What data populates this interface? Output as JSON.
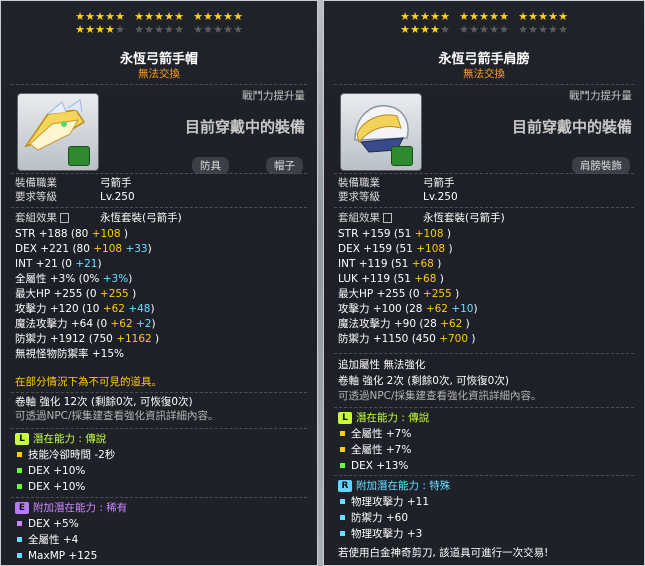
{
  "left": {
    "stars": {
      "row1": 15,
      "row2_on": 4,
      "row2_total": 15
    },
    "title": "永恆弓箭手帽",
    "untradeable": "無法交換",
    "cp_label": "戰鬥力提升量",
    "equipped": "目前穿戴中的裝備",
    "tags": [
      "防具",
      "帽子"
    ],
    "job_label": "裝備職業",
    "job": "弓箭手",
    "level_label": "要求等級",
    "level": "Lv.250",
    "set_label": "套組效果",
    "set": "永恆套裝(弓箭手)",
    "stats": [
      {
        "name": "STR",
        "total": "+188",
        "base": "(80",
        "a": "+108",
        "b": "",
        "close": ")"
      },
      {
        "name": "DEX",
        "total": "+221",
        "base": "(80",
        "a": "+108",
        "b": "+33",
        "close": ")"
      },
      {
        "name": "INT",
        "total": "+21",
        "base": "(0",
        "a": "",
        "b": "+21",
        "close": ")"
      },
      {
        "name": "全屬性",
        "total": "+3%",
        "base": "(0%",
        "a": "",
        "b": "+3%",
        "close": ")"
      },
      {
        "name": "最大HP",
        "total": "+255",
        "base": "(0",
        "a": "+255",
        "b": "",
        "close": ")"
      },
      {
        "name": "攻擊力",
        "total": "+120",
        "base": "(10",
        "a": "+62",
        "b": "+48",
        "close": ")"
      },
      {
        "name": "魔法攻擊力",
        "total": "+64",
        "base": "(0",
        "a": "+62",
        "b": "+2",
        "close": ")"
      },
      {
        "name": "防禦力",
        "total": "+1912",
        "base": "(750",
        "a": "+1162",
        "b": "",
        "close": ")"
      },
      {
        "name": "無視怪物防禦率",
        "total": "+15%",
        "base": "",
        "a": "",
        "b": "",
        "close": ""
      }
    ],
    "note_invisible": "在部分情況下為不可見的道具。",
    "scroll": "卷軸 強化 12次 (剩餘0次, 可恢復0次)",
    "npc_note": "可透過NPC/採集建查看強化資訊詳細內容。",
    "potential_title": "潛在能力 : 傳說",
    "potential": [
      "技能冷卻時間 -2秒",
      "DEX +10%",
      "DEX +10%"
    ],
    "add_potential_title": "附加潛在能力 : 稀有",
    "add_potential": [
      "DEX +5%",
      "全屬性 +4",
      "MaxMP +125"
    ]
  },
  "right": {
    "stars": {
      "row1": 15,
      "row2_on": 4,
      "row2_total": 15
    },
    "title": "永恆弓箭手肩膀",
    "untradeable": "無法交換",
    "cp_label": "戰鬥力提升量",
    "equipped": "目前穿戴中的裝備",
    "tags": [
      "肩膀裝飾"
    ],
    "job_label": "裝備職業",
    "job": "弓箭手",
    "level_label": "要求等級",
    "level": "Lv.250",
    "set_label": "套組效果",
    "set": "永恆套裝(弓箭手)",
    "stats": [
      {
        "name": "STR",
        "total": "+159",
        "base": "(51",
        "a": "+108",
        "b": "",
        "close": ")"
      },
      {
        "name": "DEX",
        "total": "+159",
        "base": "(51",
        "a": "+108",
        "b": "",
        "close": ")"
      },
      {
        "name": "INT",
        "total": "+119",
        "base": "(51",
        "a": "+68",
        "b": "",
        "close": ")"
      },
      {
        "name": "LUK",
        "total": "+119",
        "base": "(51",
        "a": "+68",
        "b": "",
        "close": ")"
      },
      {
        "name": "最大HP",
        "total": "+255",
        "base": "(0",
        "a": "+255",
        "b": "",
        "close": ")"
      },
      {
        "name": "攻擊力",
        "total": "+100",
        "base": "(28",
        "a": "+62",
        "b": "+10",
        "close": ")"
      },
      {
        "name": "魔法攻擊力",
        "total": "+90",
        "base": "(28",
        "a": "+62",
        "b": "",
        "close": ")"
      },
      {
        "name": "防禦力",
        "total": "+1150",
        "base": "(450",
        "a": "+700",
        "b": "",
        "close": ")"
      }
    ],
    "extra_attr": "追加屬性 無法強化",
    "scroll": "卷軸 強化 2次 (剩餘0次, 可恢復0次)",
    "npc_note": "可透過NPC/採集建查看強化資訊詳細內容。",
    "potential_title": "潛在能力 : 傳說",
    "potential": [
      "全屬性 +7%",
      "全屬性 +7%",
      "DEX +13%"
    ],
    "add_potential_title": "附加潛在能力 : 特殊",
    "add_potential": [
      "物理攻擊力 +11",
      "防禦力 +60",
      "物理攻擊力 +3"
    ],
    "footer": "若使用白金神奇剪刀, 該道具可進行一次交易!"
  },
  "colors": {
    "star_on": "#ffd11a",
    "upgrade_yellow": "#ffcc00",
    "potential_green": "#66ff33",
    "legend_badge": "#c6ff3a",
    "epic_badge": "#b77bff",
    "rare_badge": "#5fd6ff"
  },
  "icons": {
    "left_item": "archer-hat-icon",
    "right_item": "archer-shoulder-icon",
    "lock": "lock-icon"
  }
}
